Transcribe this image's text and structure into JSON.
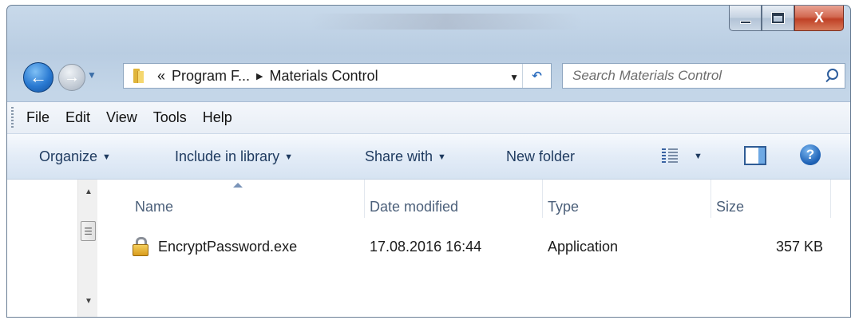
{
  "window": {
    "caption_buttons": {
      "minimize": "",
      "maximize": "",
      "close": "X"
    }
  },
  "nav": {
    "back_glyph": "←",
    "forward_glyph": "→",
    "address": {
      "overflow": "«",
      "crumbs": [
        "Program F...",
        "Materials Control"
      ],
      "separator": "▶",
      "dropdown": "▼",
      "refresh_glyph": "↶"
    },
    "search": {
      "placeholder": "Search Materials Control"
    }
  },
  "menubar": {
    "items": [
      "File",
      "Edit",
      "View",
      "Tools",
      "Help"
    ]
  },
  "commandbar": {
    "organize": "Organize",
    "include_in_library": "Include in library",
    "share_with": "Share with",
    "new_folder": "New folder",
    "dropdown_arrow": "▼",
    "help_glyph": "?"
  },
  "filelist": {
    "columns": [
      "Name",
      "Date modified",
      "Type",
      "Size"
    ],
    "sorted_column": "Name",
    "rows": [
      {
        "name": "EncryptPassword.exe",
        "date_modified": "17.08.2016 16:44",
        "type": "Application",
        "size": "357 KB",
        "icon": "lock-icon"
      }
    ]
  },
  "colors": {
    "frame": "#b9cde2",
    "command_text": "#1e3a5f",
    "header_text": "#4c607a",
    "close_button": "#c04126"
  }
}
